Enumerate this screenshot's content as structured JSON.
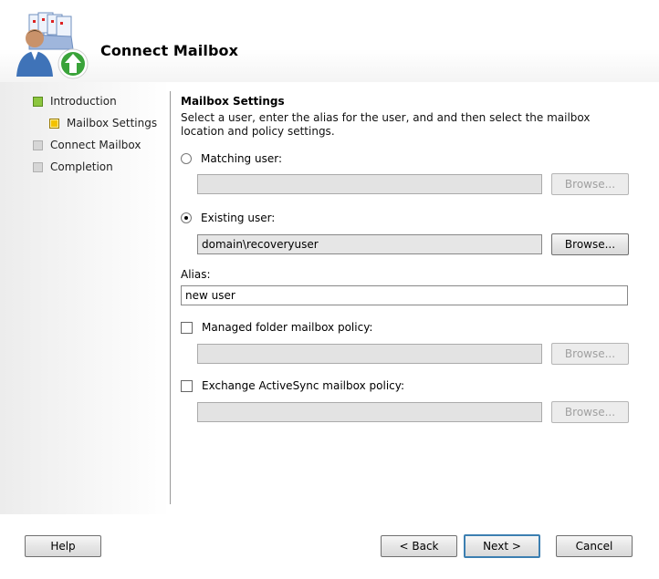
{
  "header": {
    "title": "Connect Mailbox",
    "icon": "connect-mailbox-wizard-icon"
  },
  "sidebar": {
    "items": [
      {
        "label": "Introduction",
        "status": "completed",
        "color": "#8cc63f"
      },
      {
        "label": "Mailbox Settings",
        "status": "current",
        "color": "#f3c200"
      },
      {
        "label": "Connect Mailbox",
        "status": "pending",
        "color": "#d6d6d6"
      },
      {
        "label": "Completion",
        "status": "pending",
        "color": "#d6d6d6"
      }
    ]
  },
  "main": {
    "section_title": "Mailbox Settings",
    "section_description": "Select a user, enter the alias for the user, and and then select the mailbox location and policy settings.",
    "matching_user": {
      "label": "Matching user:",
      "checked": false,
      "value": "",
      "browse_label": "Browse..."
    },
    "existing_user": {
      "label": "Existing user:",
      "checked": true,
      "value": "domain\\recoveryuser",
      "browse_label": "Browse..."
    },
    "alias": {
      "label": "Alias:",
      "value": "new user"
    },
    "managed_folder_policy": {
      "label": "Managed folder mailbox policy:",
      "checked": false,
      "value": "",
      "browse_label": "Browse..."
    },
    "activesync_policy": {
      "label": "Exchange ActiveSync mailbox policy:",
      "checked": false,
      "value": "",
      "browse_label": "Browse..."
    }
  },
  "footer": {
    "help_label": "Help",
    "back_label": "< Back",
    "next_label": "Next >",
    "cancel_label": "Cancel"
  }
}
